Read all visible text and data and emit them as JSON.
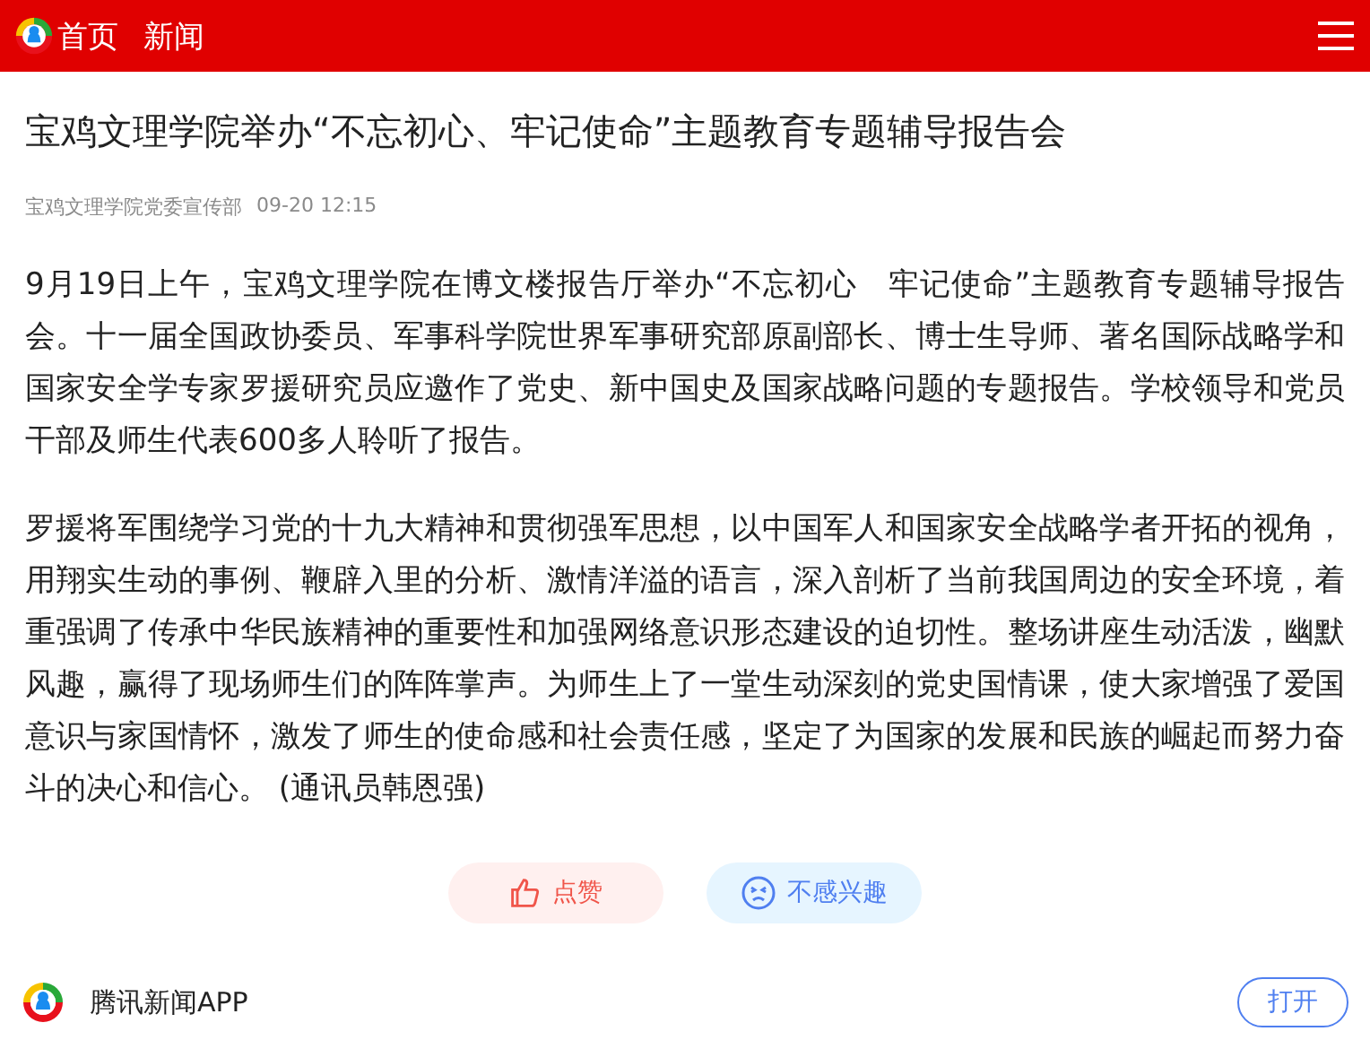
{
  "header": {
    "nav": [
      "首页",
      "新闻"
    ]
  },
  "article": {
    "title": "宝鸡文理学院举办“不忘初心、牢记使命”主题教育专题辅导报告会",
    "source": "宝鸡文理学院党委宣传部",
    "time": "09-20 12:15",
    "paragraphs": [
      "9月19日上午，宝鸡文理学院在博文楼报告厅举办“不忘初心　牢记使命”主题教育专题辅导报告会。十一届全国政协委员、军事科学院世界军事研究部原副部长、博士生导师、著名国际战略学和国家安全学专家罗援研究员应邀作了党史、新中国史及国家战略问题的专题报告。学校领导和党员干部及师生代表600多人聆听了报告。",
      "罗援将军围绕学习党的十九大精神和贯彻强军思想，以中国军人和国家安全战略学者开拓的视角，用翔实生动的事例、鞭辟入里的分析、激情洋溢的语言，深入剖析了当前我国周边的安全环境，着重强调了传承中华民族精神的重要性和加强网络意识形态建设的迫切性。整场讲座生动活泼，幽默风趣，赢得了现场师生们的阵阵掌声。为师生上了一堂生动深刻的党史国情课，使大家增强了爱国意识与家国情怀，激发了师生的使命感和社会责任感，坚定了为国家的发展和民族的崛起而努力奋斗的决心和信心。 (通讯员韩恩强)"
    ]
  },
  "reactions": [
    {
      "kind": "like",
      "label": "点赞"
    },
    {
      "kind": "dislike",
      "label": "不感兴趣"
    }
  ],
  "footer": {
    "app_name": "腾讯新闻APP",
    "open_button": "打开"
  }
}
